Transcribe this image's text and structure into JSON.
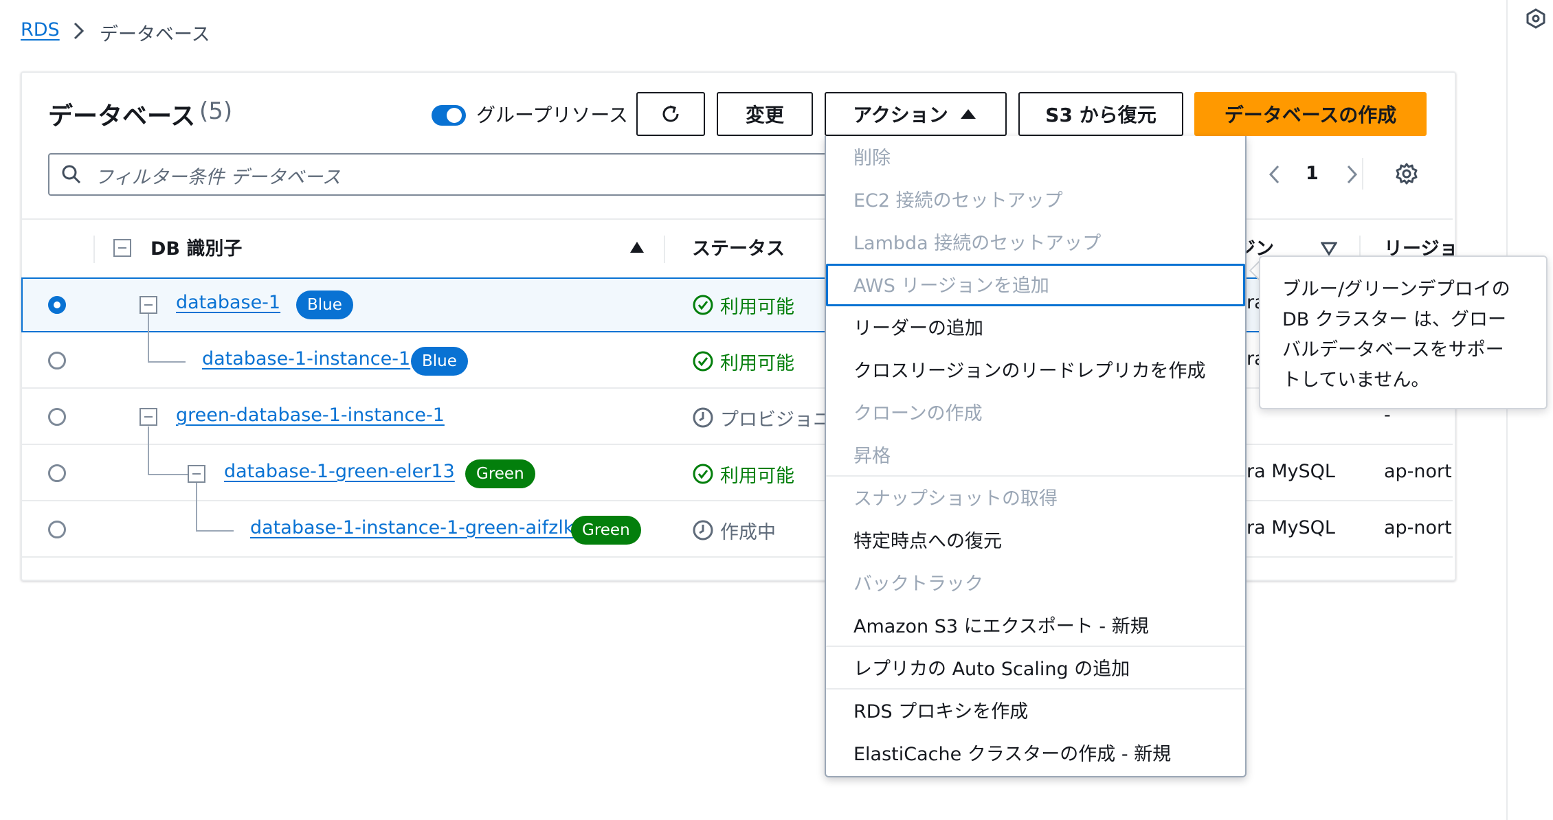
{
  "breadcrumb": {
    "root": "RDS",
    "current": "データベース"
  },
  "panel": {
    "title": "データベース",
    "count": "(5)",
    "group_toggle_label": "グループリソース",
    "group_toggle_on": true,
    "buttons": {
      "modify": "変更",
      "actions": "アクション",
      "restore_s3": "S3 から復元",
      "create": "データベースの作成"
    },
    "search_placeholder": "フィルター条件 データベース",
    "page_number": "1"
  },
  "columns": {
    "db_id": "DB 識別子",
    "status": "ステータス",
    "engine": "ジン",
    "region": "リージョ"
  },
  "rows": [
    {
      "id": "database-1",
      "badge": "Blue",
      "status": "利用可能",
      "engine": "ra",
      "region": ""
    },
    {
      "id": "database-1-instance-1",
      "badge": "Blue",
      "status": "利用可能",
      "engine": "ra",
      "region": ""
    },
    {
      "id": "green-database-1-instance-1",
      "badge": "",
      "status": "プロビジョニ",
      "engine": "",
      "region": "-"
    },
    {
      "id": "database-1-green-eler13",
      "badge": "Green",
      "status": "利用可能",
      "engine": "ra MySQL",
      "region": "ap-northeast"
    },
    {
      "id": "database-1-instance-1-green-aifzlk",
      "badge": "Green",
      "status": "作成中",
      "engine": "ra MySQL",
      "region": "ap-northeast"
    }
  ],
  "actions_menu": [
    {
      "label": "削除",
      "enabled": false
    },
    {
      "label": "EC2 接続のセットアップ",
      "enabled": false
    },
    {
      "label": "Lambda 接続のセットアップ",
      "enabled": false
    },
    {
      "label": "AWS リージョンを追加",
      "enabled": false,
      "focused": true
    },
    {
      "label": "リーダーの追加",
      "enabled": true
    },
    {
      "label": "クロスリージョンのリードレプリカを作成",
      "enabled": true
    },
    {
      "label": "クローンの作成",
      "enabled": false
    },
    {
      "label": "昇格",
      "enabled": false
    },
    {
      "label": "スナップショットの取得",
      "enabled": false
    },
    {
      "label": "特定時点への復元",
      "enabled": true
    },
    {
      "label": "バックトラック",
      "enabled": false
    },
    {
      "label": "Amazon S3 にエクスポート - 新規",
      "enabled": true
    },
    {
      "label": "レプリカの Auto Scaling の追加",
      "enabled": true
    },
    {
      "label": "RDS プロキシを作成",
      "enabled": true
    },
    {
      "label": "ElastiCache クラスターの作成 - 新規",
      "enabled": true
    }
  ],
  "tooltip": {
    "lines": [
      "ブルー/グリーンデプロイの",
      "DB クラスター は、グロー",
      "バルデータベースをサポー",
      "トしていません。"
    ]
  },
  "colors": {
    "link": "#0972d3",
    "primary": "#ff9900",
    "success": "#037f0c",
    "disabled": "#9ba7b6"
  }
}
